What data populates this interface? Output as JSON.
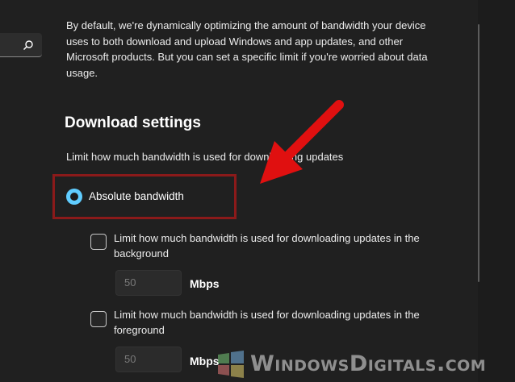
{
  "intro_text": "By default, we're dynamically optimizing the amount of bandwidth your device uses to both download and upload Windows and app updates, and other Microsoft products. But you can set a specific limit if you're worried about data usage.",
  "section_title": "Download settings",
  "subtitle": "Limit how much bandwidth is used for downloading updates",
  "radio": {
    "label": "Absolute bandwidth",
    "selected": true
  },
  "background": {
    "label": "Limit how much bandwidth is used for downloading updates in the background",
    "checked": false,
    "value": "50",
    "unit": "Mbps"
  },
  "foreground": {
    "label": "Limit how much bandwidth is used for downloading updates in the foreground",
    "checked": false,
    "value": "50",
    "unit": "Mbps"
  },
  "watermark": "WindowsDigitals.com",
  "colors": {
    "accent": "#60cdff",
    "highlight": "#8b1a1a",
    "arrow": "#e01010"
  }
}
